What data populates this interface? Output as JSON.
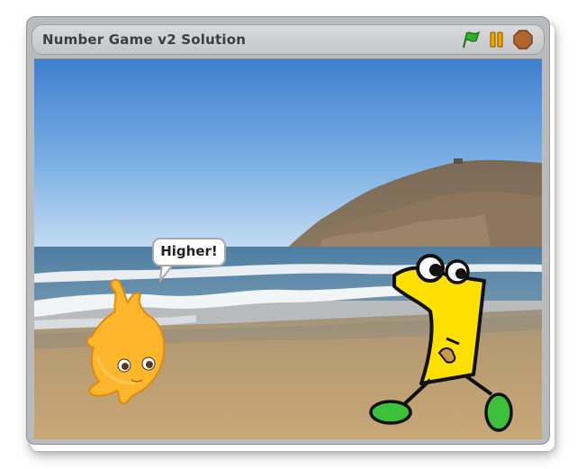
{
  "window": {
    "title": "Number Game v2 Solution"
  },
  "controls": {
    "green_flag": "green-flag-icon",
    "pause": "pause-icon",
    "stop": "stop-icon"
  },
  "stage": {
    "speech_bubble": "Higher!"
  },
  "colors": {
    "flag_green": "#2fae2b",
    "pause_orange": "#f2a200",
    "stop_brown": "#b2642e",
    "sprite_yellow": "#ffe000",
    "sprite_orange": "#ffb62a",
    "shoe_green": "#3cc23a"
  }
}
